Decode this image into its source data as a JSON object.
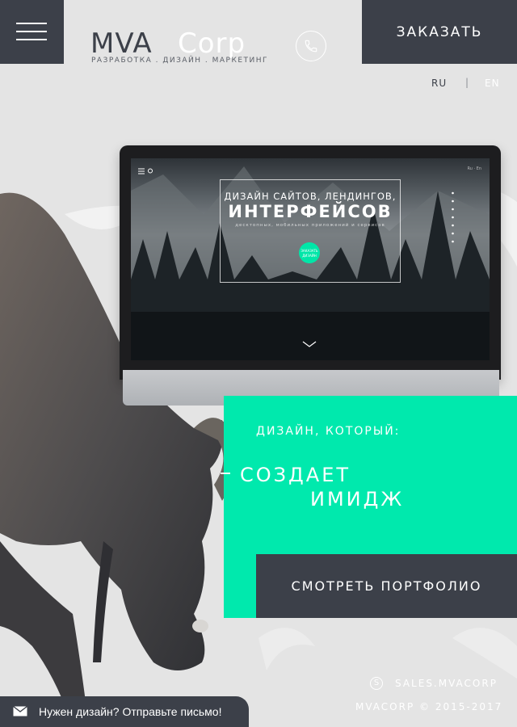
{
  "header": {
    "menu_icon": "hamburger-icon",
    "logo": {
      "part1": "MVA",
      "part2": "Corp",
      "tagline": "РАЗРАБОТКА . ДИЗАЙН . МАРКЕТИНГ"
    },
    "phone_icon": "phone-icon",
    "order_label": "ЗАКАЗАТЬ"
  },
  "languages": [
    "RU",
    "EN"
  ],
  "screen_preview": {
    "line1": "ДИЗАЙН САЙТОВ, ЛЕНДИНГОВ,",
    "line2": "ИНТЕРФЕЙСОВ",
    "line3": "десктопных, мобильных приложений и сервисов",
    "cta": "ЗАКАЗАТЬ ДИЗАЙН"
  },
  "promo": {
    "title": "ДИЗАЙН, КОТОРЫЙ:",
    "line1": "СОЗДАЕТ",
    "line2": "ИМИДЖ",
    "portfolio_label": "СМОТРЕТЬ ПОРТФОЛИО"
  },
  "footer": {
    "skype": "SALES.MVACORP",
    "copyright": "MVACORP © 2015-2017"
  },
  "mail_bar": {
    "text": "Нужен дизайн? Отправьте письмо!"
  },
  "colors": {
    "dark": "#3c4049",
    "accent": "#00e9ad",
    "background": "#e4e4e4"
  }
}
